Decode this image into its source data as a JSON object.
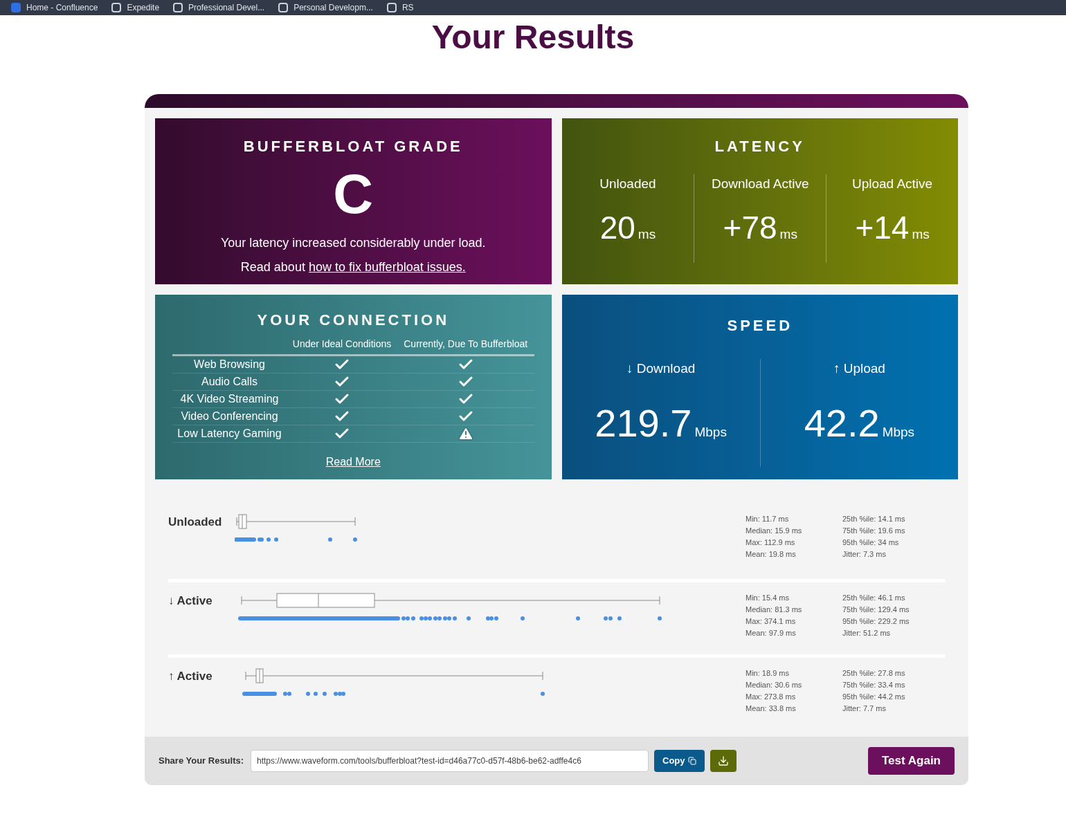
{
  "bookmarks": [
    {
      "label": "Home - Confluence",
      "kind": "app"
    },
    {
      "label": "Expedite",
      "kind": "folder"
    },
    {
      "label": "Professional Devel...",
      "kind": "folder"
    },
    {
      "label": "Personal Developm...",
      "kind": "folder"
    },
    {
      "label": "RS",
      "kind": "folder"
    }
  ],
  "title": "Your Results",
  "grade": {
    "heading": "BUFFERBLOAT GRADE",
    "grade": "C",
    "message": "Your latency increased considerably under load.",
    "read_prefix": "Read about",
    "link": "how to fix bufferbloat issues."
  },
  "latency": {
    "heading": "LATENCY",
    "columns": [
      {
        "label": "Unloaded",
        "value": "20",
        "unit": "ms"
      },
      {
        "label": "Download Active",
        "value": "+78",
        "unit": "ms"
      },
      {
        "label": "Upload Active",
        "value": "+14",
        "unit": "ms"
      }
    ]
  },
  "connection": {
    "heading": "YOUR CONNECTION",
    "columns": [
      "Under Ideal Conditions",
      "Currently, Due To Bufferbloat"
    ],
    "rows": [
      {
        "label": "Web Browsing",
        "ideal_ok": true,
        "current_ok": true
      },
      {
        "label": "Audio Calls",
        "ideal_ok": true,
        "current_ok": true
      },
      {
        "label": "4K Video Streaming",
        "ideal_ok": true,
        "current_ok": true
      },
      {
        "label": "Video Conferencing",
        "ideal_ok": true,
        "current_ok": true
      },
      {
        "label": "Low Latency Gaming",
        "ideal_ok": true,
        "current_ok": false
      }
    ],
    "link": "Read More"
  },
  "speed": {
    "heading": "SPEED",
    "columns": [
      {
        "label": "↓ Download",
        "value": "219.7",
        "unit": "Mbps"
      },
      {
        "label": "↑ Upload",
        "value": "42.2",
        "unit": "Mbps"
      }
    ]
  },
  "distributions": [
    {
      "label": "Unloaded",
      "stats_left": [
        "Min: 11.7 ms",
        "Median: 15.9 ms",
        "Max: 112.9 ms",
        "Mean: 19.8 ms"
      ],
      "stats_right": [
        "25th %ile: 14.1 ms",
        "75th %ile: 19.6 ms",
        "95th %ile: 34 ms",
        "Jitter: 7.3 ms"
      ]
    },
    {
      "label": "↓ Active",
      "stats_left": [
        "Min: 15.4 ms",
        "Median: 81.3 ms",
        "Max: 374.1 ms",
        "Mean: 97.9 ms"
      ],
      "stats_right": [
        "25th %ile: 46.1 ms",
        "75th %ile: 129.4 ms",
        "95th %ile: 229.2 ms",
        "Jitter: 51.2 ms"
      ]
    },
    {
      "label": "↑ Active",
      "stats_left": [
        "Min: 18.9 ms",
        "Median: 30.6 ms",
        "Max: 273.8 ms",
        "Mean: 33.8 ms"
      ],
      "stats_right": [
        "25th %ile: 27.8 ms",
        "75th %ile: 33.4 ms",
        "95th %ile: 44.2 ms",
        "Jitter: 7.7 ms"
      ]
    }
  ],
  "share": {
    "label": "Share Your Results:",
    "url": "https://www.waveform.com/tools/bufferbloat?test-id=d46a77c0-d57f-48b6-be62-adffe4c6",
    "copy": "Copy",
    "test_again": "Test Again"
  }
}
